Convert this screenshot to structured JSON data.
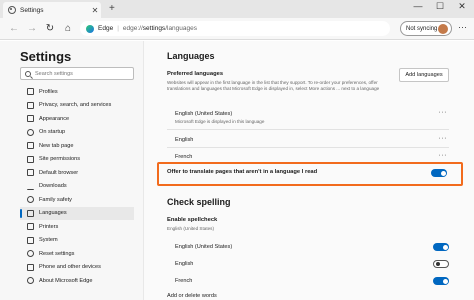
{
  "window": {
    "tab_title": "Settings",
    "tab_close": "✕",
    "new_tab": "+",
    "minimize": "—",
    "maximize": "☐",
    "close": "✕"
  },
  "nav": {
    "back": "←",
    "forward": "→",
    "refresh": "↻",
    "home": "⌂"
  },
  "address": {
    "host": "Edge",
    "separator": "|",
    "url_scheme_host": "edge://",
    "url_bold": "settings",
    "url_path": "/languages"
  },
  "profile": {
    "sync_label": "Not syncing",
    "menu": "···"
  },
  "sidebar": {
    "title": "Settings",
    "search_placeholder": "Search settings",
    "items": [
      {
        "label": "Profiles",
        "icon": "profile-icon"
      },
      {
        "label": "Privacy, search, and services",
        "icon": "lock-icon"
      },
      {
        "label": "Appearance",
        "icon": "appearance-icon"
      },
      {
        "label": "On startup",
        "icon": "power-icon"
      },
      {
        "label": "New tab page",
        "icon": "new-tab-icon"
      },
      {
        "label": "Site permissions",
        "icon": "site-permissions-icon"
      },
      {
        "label": "Default browser",
        "icon": "browser-icon"
      },
      {
        "label": "Downloads",
        "icon": "download-icon"
      },
      {
        "label": "Family safety",
        "icon": "family-icon"
      },
      {
        "label": "Languages",
        "icon": "languages-icon",
        "selected": true
      },
      {
        "label": "Printers",
        "icon": "printer-icon"
      },
      {
        "label": "System",
        "icon": "system-icon"
      },
      {
        "label": "Reset settings",
        "icon": "reset-icon"
      },
      {
        "label": "Phone and other devices",
        "icon": "phone-icon"
      },
      {
        "label": "About Microsoft Edge",
        "icon": "edge-icon"
      }
    ]
  },
  "languages": {
    "title": "Languages",
    "preferred_title": "Preferred languages",
    "preferred_desc": "Websites will appear in the first language in the list that they support. To re-order your preferences, offer translations and languages that Microsoft Edge is displayed in, select More actions ... next to a language",
    "add_button": "Add languages",
    "list": [
      {
        "name": "English (United States)",
        "note": "Microsoft Edge is displayed in this language"
      },
      {
        "name": "English",
        "note": ""
      },
      {
        "name": "French",
        "note": ""
      }
    ],
    "more_actions": "···",
    "translate_label": "Offer to translate pages that aren't in a language I read",
    "translate_on": true
  },
  "spellcheck": {
    "title": "Check spelling",
    "enable_label": "Enable spellcheck",
    "enable_sub": "English (United States)",
    "languages": [
      {
        "name": "English (United States)",
        "on": true
      },
      {
        "name": "English",
        "on": false
      },
      {
        "name": "French",
        "on": false
      }
    ],
    "add_dictionary": "Add or delete words"
  },
  "colors": {
    "accent": "#0067c0",
    "highlight": "#f26b1d"
  }
}
